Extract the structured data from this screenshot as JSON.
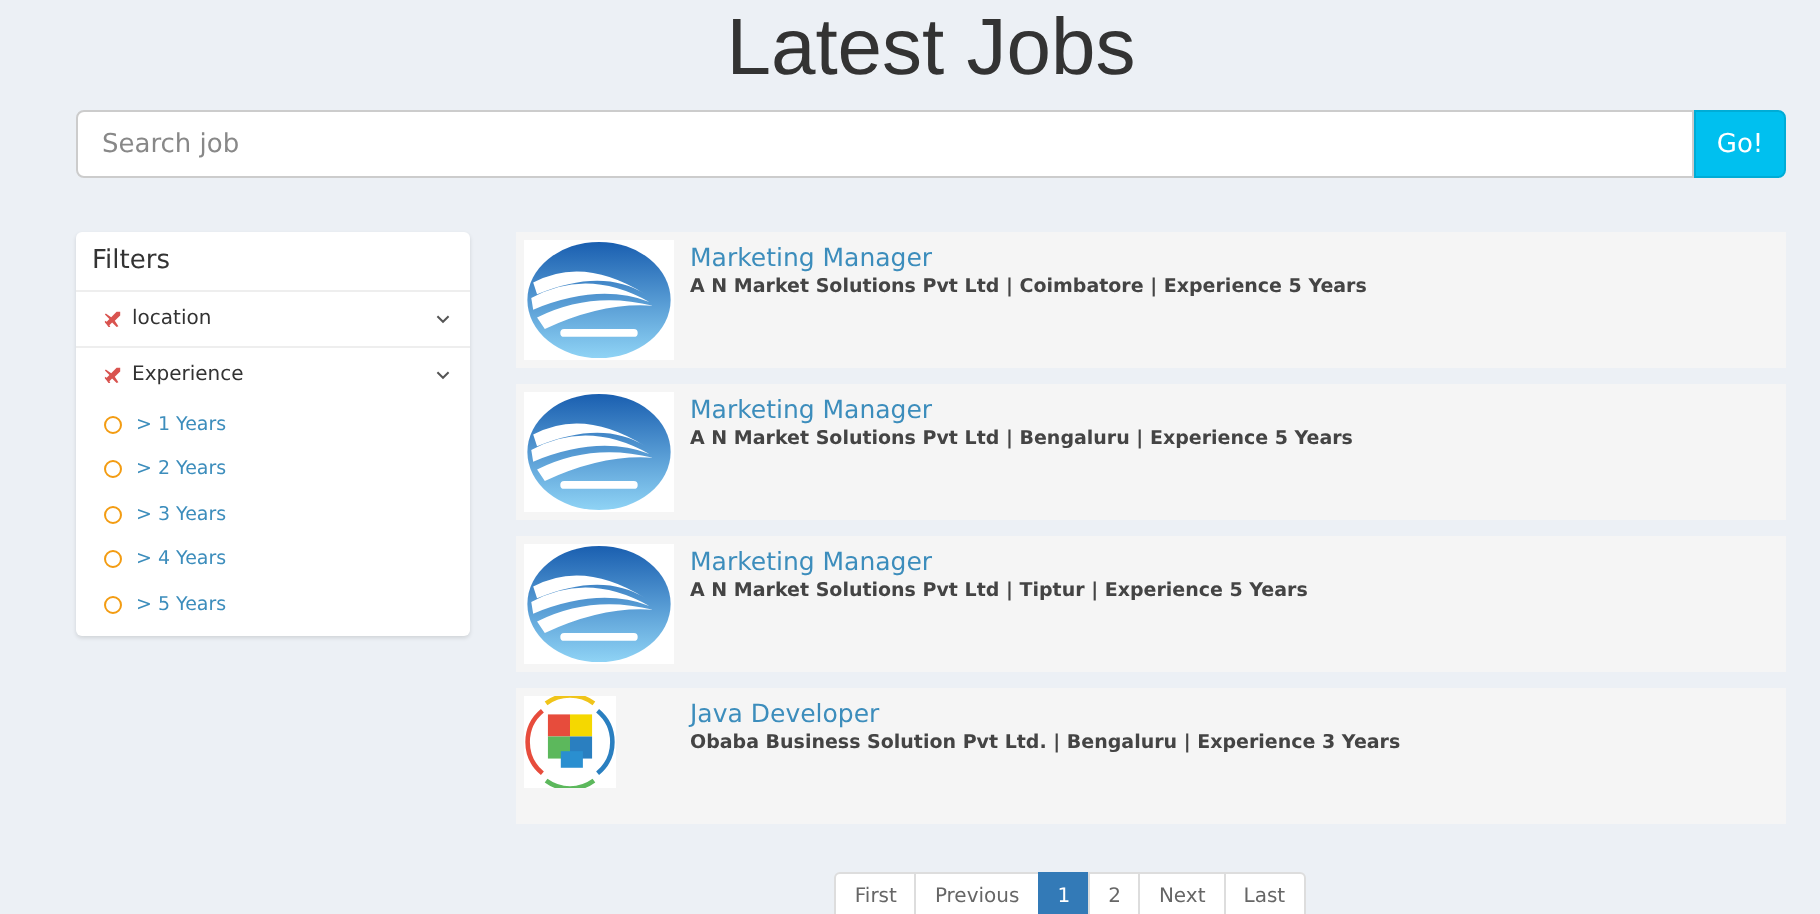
{
  "title": "Latest Jobs",
  "search": {
    "placeholder": "Search job",
    "button": "Go!"
  },
  "filters": {
    "title": "Filters",
    "groups": [
      {
        "label": "location"
      },
      {
        "label": "Experience",
        "expanded": true,
        "options": [
          {
            "label": "> 1 Years",
            "selected": false
          },
          {
            "label": "> 2 Years",
            "selected": false
          },
          {
            "label": "> 3 Years",
            "selected": false
          },
          {
            "label": "> 4 Years",
            "selected": false
          },
          {
            "label": "> 5 Years",
            "selected": false
          }
        ]
      }
    ]
  },
  "jobs": [
    {
      "kind": "waves",
      "title": "Marketing Manager",
      "details": "A N Market Solutions Pvt Ltd | Coimbatore | Experience 5 Years"
    },
    {
      "kind": "waves",
      "title": "Marketing Manager",
      "details": "A N Market Solutions Pvt Ltd | Bengaluru | Experience 5 Years"
    },
    {
      "kind": "waves",
      "title": "Marketing Manager",
      "details": "A N Market Solutions Pvt Ltd | Tiptur | Experience 5 Years"
    },
    {
      "kind": "puzzle",
      "title": "Java Developer",
      "details": "Obaba Business Solution Pvt Ltd. | Bengaluru | Experience 3 Years"
    }
  ],
  "pagination": [
    {
      "label": "First",
      "selected": false
    },
    {
      "label": "Previous",
      "selected": false
    },
    {
      "label": "1",
      "selected": true
    },
    {
      "label": "2",
      "selected": false
    },
    {
      "label": "Next",
      "selected": false
    },
    {
      "label": "Last",
      "selected": false
    }
  ]
}
